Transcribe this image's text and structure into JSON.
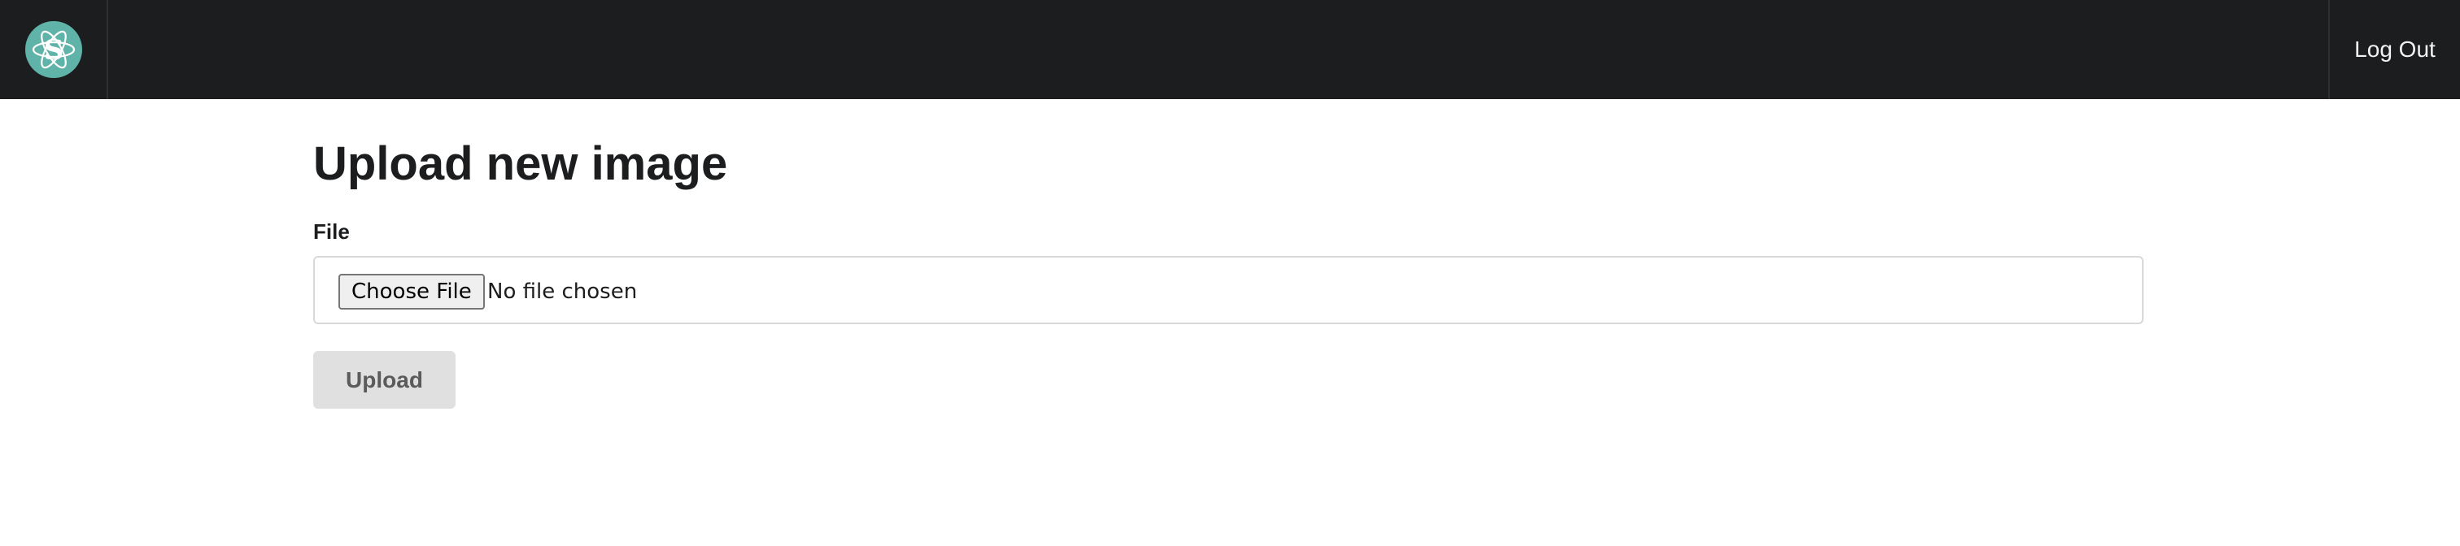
{
  "header": {
    "logo_letter": "S",
    "logout_label": "Log Out"
  },
  "main": {
    "title": "Upload new image",
    "file_label": "File",
    "choose_file_label": "Choose File",
    "no_file_text": "No file chosen",
    "upload_label": "Upload"
  },
  "colors": {
    "topbar": "#1c1d1f",
    "logo": "#5fb3a8",
    "upload_button_bg": "#e0e0e0"
  },
  "icons": {
    "logo": "atom-s-logo-icon"
  }
}
